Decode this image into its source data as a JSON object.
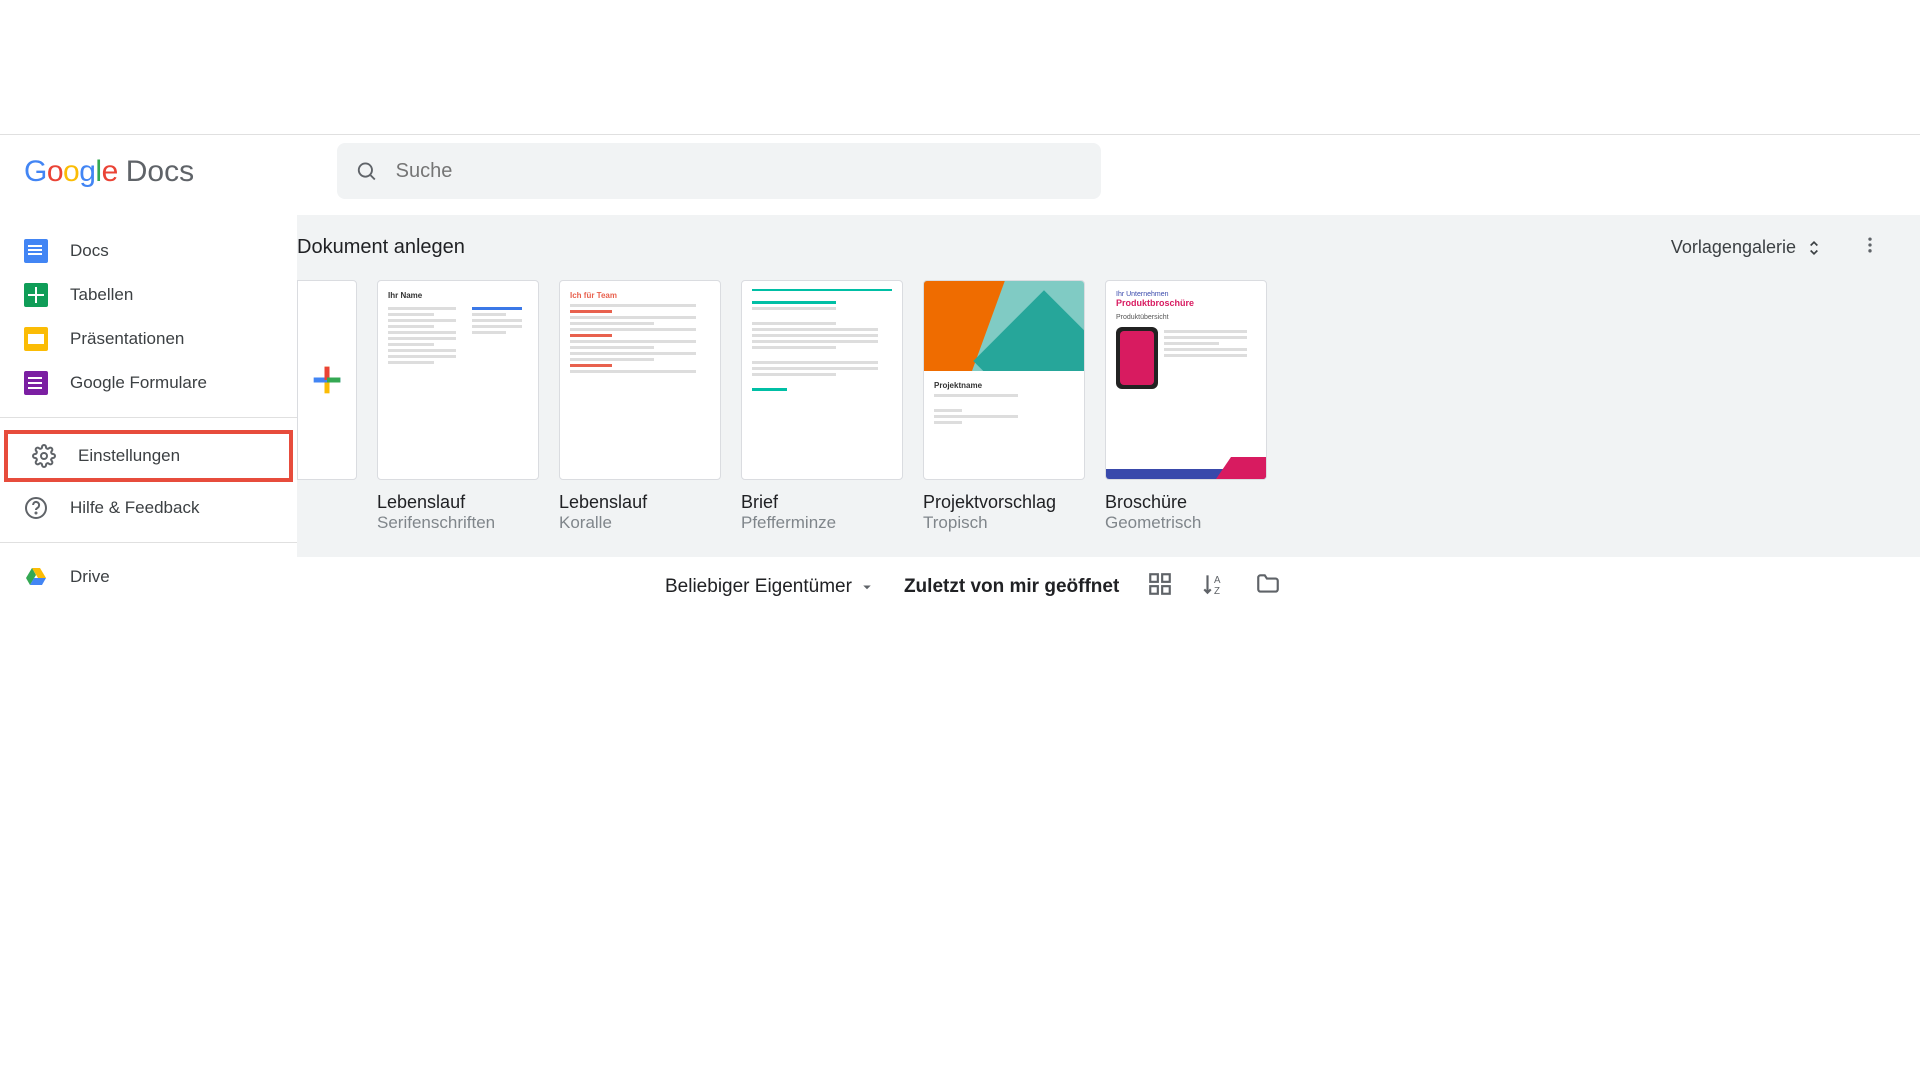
{
  "brand": {
    "google": "Google",
    "app": "Docs"
  },
  "sidebar": {
    "items": [
      {
        "label": "Docs"
      },
      {
        "label": "Tabellen"
      },
      {
        "label": "Präsentationen"
      },
      {
        "label": "Google Formulare"
      }
    ],
    "settings": "Einstellungen",
    "help": "Hilfe & Feedback",
    "drive": "Drive"
  },
  "search": {
    "placeholder": "Suche"
  },
  "templates": {
    "header": "Dokument anlegen",
    "gallery_label": "Vorlagengalerie",
    "cards": [
      {
        "name": "Lebenslauf",
        "sub": "Serifenschriften",
        "thumb": {
          "title": "Ihr Name",
          "accent": "#3b78e7"
        }
      },
      {
        "name": "Lebenslauf",
        "sub": "Koralle",
        "thumb": {
          "title": "Ich für Team",
          "accent": "#e8614e"
        }
      },
      {
        "name": "Brief",
        "sub": "Pfefferminze",
        "thumb": {
          "title": "",
          "accent": "#00bfa5"
        }
      },
      {
        "name": "Projektvorschlag",
        "sub": "Tropisch",
        "thumb": {
          "title": "Projektname",
          "accent": "#26a69a"
        }
      },
      {
        "name": "Broschüre",
        "sub": "Geometrisch",
        "thumb": {
          "title": "Produktbroschüre",
          "accent": "#3949ab"
        }
      }
    ]
  },
  "footer": {
    "owner_filter": "Beliebiger Eigentümer",
    "sort": "Zuletzt von mir geöffnet"
  }
}
